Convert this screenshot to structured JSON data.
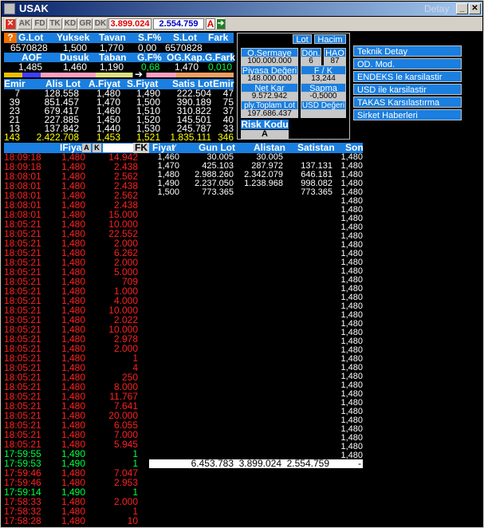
{
  "window": {
    "title": "USAK",
    "right_label": "Detay"
  },
  "toolbar": {
    "buttons": [
      "AK",
      "FD",
      "TK",
      "KD",
      "GR",
      "DK"
    ],
    "value1": "3.899.024",
    "value2": "2.554.759",
    "badge": "A"
  },
  "summary": {
    "row1_headers": [
      "G.Lot",
      "Yuksek",
      "Tavan",
      "S.F%",
      "S.Lot",
      "Fark"
    ],
    "row1_values": [
      "6570828",
      "1,500",
      "1,770",
      "0,00",
      "6570828",
      ""
    ],
    "row2_headers": [
      "AOF",
      "Dusuk",
      "Taban",
      "G.F%",
      "OG.Kap.",
      "G.Fark"
    ],
    "row2_values": [
      "1,485",
      "1,460",
      "1,190",
      "0,68",
      "1,470",
      "0,010"
    ]
  },
  "depth": {
    "headers": [
      "Emir",
      "Alis Lot",
      "A.Fiyat",
      "S.Fiyat",
      "Satis Lot",
      "Emir"
    ],
    "rows": [
      [
        "7",
        "128.558",
        "1,480",
        "1,490",
        "222.504",
        "47"
      ],
      [
        "39",
        "851.457",
        "1,470",
        "1,500",
        "390.189",
        "75"
      ],
      [
        "23",
        "679.417",
        "1,460",
        "1,510",
        "310.822",
        "37"
      ],
      [
        "21",
        "227.885",
        "1,450",
        "1,520",
        "145.501",
        "40"
      ],
      [
        "13",
        "137.842",
        "1,440",
        "1,530",
        "245.787",
        "33"
      ]
    ],
    "totals": [
      "143",
      "2.422.708",
      "1,453",
      "1,521",
      "1.835.111",
      "346"
    ]
  },
  "info_panel": {
    "buttons": [
      "Lot",
      "Hacim"
    ],
    "o_sermaye_label": "O.Sermaye",
    "o_sermaye_value": "100.000.000",
    "don_label": "Dön.",
    "don_value": "6",
    "hao_label": "HAO",
    "hao_value": "87",
    "piyasa_label": "Piyasa Değeri",
    "piyasa_value": "148.000.000",
    "fk_label": "F / K",
    "fk_value": "13,244",
    "netkar_label": "Net Kar",
    "netkar_value": "9.572.942",
    "sapma_label": "Sapma",
    "sapma_value": "-0,5000",
    "toplam_label": "ply.Toplam Lot",
    "toplam_value": "197.686.437",
    "usd_label": "USD Değeri",
    "usd_value": "",
    "risk_label": "Risk Kodu",
    "risk_value": "A"
  },
  "right_menu": [
    "Teknik Detay",
    "OD. Mod.",
    "ENDEKS le karsilastir",
    "USD ile karsilastir",
    "TAKAS Karsılastırma",
    "Sirket Haberleri"
  ],
  "trades": {
    "headers": {
      "time": "",
      "price": "IFiyat",
      "a_btn": "A",
      "k_btn": "K",
      "lot": "",
      "fk": "FK"
    },
    "rows": [
      {
        "t": "18:09:18",
        "p": "1,480",
        "l": "14.942",
        "c": "red"
      },
      {
        "t": "18:09:18",
        "p": "1,480",
        "l": "2.438",
        "c": "red"
      },
      {
        "t": "18:08:01",
        "p": "1,480",
        "l": "2.562",
        "c": "red"
      },
      {
        "t": "18:08:01",
        "p": "1,480",
        "l": "2.438",
        "c": "red"
      },
      {
        "t": "18:08:01",
        "p": "1,480",
        "l": "2.562",
        "c": "red"
      },
      {
        "t": "18:08:01",
        "p": "1,480",
        "l": "2.438",
        "c": "red"
      },
      {
        "t": "18:08:01",
        "p": "1,480",
        "l": "15.000",
        "c": "red"
      },
      {
        "t": "18:05:21",
        "p": "1,480",
        "l": "10.000",
        "c": "red"
      },
      {
        "t": "18:05:21",
        "p": "1,480",
        "l": "22.552",
        "c": "red"
      },
      {
        "t": "18:05:21",
        "p": "1,480",
        "l": "2.000",
        "c": "red"
      },
      {
        "t": "18:05:21",
        "p": "1,480",
        "l": "6.262",
        "c": "red"
      },
      {
        "t": "18:05:21",
        "p": "1,480",
        "l": "2.000",
        "c": "red"
      },
      {
        "t": "18:05:21",
        "p": "1,480",
        "l": "5.000",
        "c": "red"
      },
      {
        "t": "18:05:21",
        "p": "1,480",
        "l": "709",
        "c": "red"
      },
      {
        "t": "18:05:21",
        "p": "1,480",
        "l": "1.000",
        "c": "red"
      },
      {
        "t": "18:05:21",
        "p": "1,480",
        "l": "4.000",
        "c": "red"
      },
      {
        "t": "18:05:21",
        "p": "1,480",
        "l": "10.000",
        "c": "red"
      },
      {
        "t": "18:05:21",
        "p": "1,480",
        "l": "2.022",
        "c": "red"
      },
      {
        "t": "18:05:21",
        "p": "1,480",
        "l": "10.000",
        "c": "red"
      },
      {
        "t": "18:05:21",
        "p": "1,480",
        "l": "2.978",
        "c": "red"
      },
      {
        "t": "18:05:21",
        "p": "1,480",
        "l": "2.000",
        "c": "red"
      },
      {
        "t": "18:05:21",
        "p": "1,480",
        "l": "1",
        "c": "red"
      },
      {
        "t": "18:05:21",
        "p": "1,480",
        "l": "4",
        "c": "red"
      },
      {
        "t": "18:05:21",
        "p": "1,480",
        "l": "250",
        "c": "red"
      },
      {
        "t": "18:05:21",
        "p": "1,480",
        "l": "8.000",
        "c": "red"
      },
      {
        "t": "18:05:21",
        "p": "1,480",
        "l": "11.767",
        "c": "red"
      },
      {
        "t": "18:05:21",
        "p": "1,480",
        "l": "7.641",
        "c": "red"
      },
      {
        "t": "18:05:21",
        "p": "1,480",
        "l": "20.000",
        "c": "red"
      },
      {
        "t": "18:05:21",
        "p": "1,480",
        "l": "6.055",
        "c": "red"
      },
      {
        "t": "18:05:21",
        "p": "1,480",
        "l": "7.000",
        "c": "red"
      },
      {
        "t": "18:05:21",
        "p": "1,480",
        "l": "5.945",
        "c": "red"
      },
      {
        "t": "17:59:55",
        "p": "1,490",
        "l": "1",
        "c": "grn"
      },
      {
        "t": "17:59:53",
        "p": "1,490",
        "l": "1",
        "c": "grn"
      },
      {
        "t": "17:59:46",
        "p": "1,480",
        "l": "7.047",
        "c": "red"
      },
      {
        "t": "17:59:46",
        "p": "1,480",
        "l": "2.953",
        "c": "red"
      },
      {
        "t": "17:59:14",
        "p": "1,490",
        "l": "1",
        "c": "grn"
      },
      {
        "t": "17:58:33",
        "p": "1,480",
        "l": "2.000",
        "c": "red"
      },
      {
        "t": "17:58:32",
        "p": "1,480",
        "l": "1",
        "c": "red"
      },
      {
        "t": "17:58:28",
        "p": "1,480",
        "l": "10",
        "c": "red"
      }
    ]
  },
  "volume": {
    "headers": [
      "Fiyat",
      "Gun Lot",
      "Alistan",
      "Satistan",
      "Son"
    ],
    "rows": [
      [
        "1,460",
        "30.005",
        "30.005",
        "",
        "1,480"
      ],
      [
        "1,470",
        "425.103",
        "287.972",
        "137.131",
        "1,480"
      ],
      [
        "1,480",
        "2.988.260",
        "2.342.079",
        "646.181",
        "1,480"
      ],
      [
        "1,490",
        "2.237.050",
        "1.238.968",
        "998.082",
        "1,480"
      ],
      [
        "1,500",
        "773.365",
        "",
        "773.365",
        "1,480"
      ]
    ],
    "son_values": [
      "1,480",
      "1,480",
      "1,480",
      "1,480",
      "1,480",
      "1,480",
      "1,480",
      "1,480",
      "1,480",
      "1,480",
      "1,480",
      "1,480",
      "1,480",
      "1,480",
      "1,480",
      "1,480",
      "1,480",
      "1,480",
      "1,480",
      "1,480",
      "1,480",
      "1,480",
      "1,480",
      "1,480",
      "1,480",
      "1,480",
      "1,480",
      "1,480",
      "1,480",
      "1,480",
      "1,480",
      "1,480",
      "1,480",
      "1,480",
      "1,480",
      "1,480",
      "1,480",
      "1,480",
      "1,480",
      "1,480",
      "1,480",
      "1,480",
      "1,480",
      "1,480",
      "1,480",
      "1,480",
      "1,480",
      "1,480",
      "1,480",
      "1,480",
      "1,480",
      "1,480",
      "1,480",
      "1,480",
      "1,480",
      "1,480",
      "1,480",
      "1,480",
      "1,480",
      "1,480",
      "1,480",
      "1,480",
      "1,480",
      "1,480",
      "1,480",
      "1,480",
      "1,480",
      "1,480",
      "1,480",
      "1,480",
      "1,480",
      "1,480",
      "1,480",
      "1,480",
      "1,480",
      "1,480",
      "1,480",
      "1,480",
      "1,480",
      "1,480",
      "1,480",
      "1,480",
      "1,480",
      "1,480",
      "1,480",
      "1,480",
      "1,480",
      "1,480",
      "1,480",
      "1,480",
      "1,480",
      "1,480",
      "1,480",
      "1,480",
      "1,480",
      "1,480",
      "1,480",
      "1,480",
      "1,480",
      "1,480",
      "1,480",
      "1,480",
      "1,480",
      "1,480",
      "1,480",
      "1,480",
      "1,480",
      "1,480",
      "1,480",
      "1,480",
      "1,480",
      "1,480",
      "1,480",
      "1,480",
      "1,480",
      "1,480",
      "1,480",
      "1,480",
      "1,480",
      "1,480",
      "1,480",
      "1,480",
      "1,480",
      "1,480",
      "1,480",
      "1,480",
      "1,480",
      "1,480",
      "1,480",
      "1,480",
      "1,480",
      "1,480",
      "1,480",
      "1,480",
      "1,480",
      "1,480",
      "1,480",
      "1,480",
      "1,480",
      "1,480",
      "1,480",
      "1,480",
      "1,480",
      "1,480",
      "1,480",
      "1,480",
      "1,480",
      "1,480",
      "1,480",
      "1,480",
      "1,480",
      "1,480",
      "1,480",
      "1,480",
      "1,480",
      "1,480",
      "1,480",
      "1,480",
      "1,480",
      "1,480",
      "1,480",
      "1,480",
      "1,480",
      "1,480",
      "1,480",
      "1,480",
      "1,480",
      "1,480",
      "1,480",
      "1,480",
      "1,480",
      "1,480",
      "1,480",
      "1,480",
      "1,480",
      "1,480",
      "1,480",
      "1,480",
      "1,480",
      "1,480",
      "1,480",
      "1,480",
      "1,480",
      "1,480",
      "1,480",
      "1,480",
      "1,480",
      "1,480",
      "1,480",
      "1,480",
      "1,480",
      "1,480",
      "1,480",
      "1,480",
      "1,480",
      "1,480",
      "1,480",
      "1,480",
      "1,480",
      "1,480",
      "1,480",
      "1,480",
      "1,480",
      "1,480",
      "1,480",
      "1,480",
      "1,480",
      "1,480",
      "1,480",
      "1,480"
    ],
    "totals": {
      "gun": "6.453.783",
      "alistan": "3.899.024",
      "satistan": "2.554.759",
      "son": "-"
    }
  }
}
